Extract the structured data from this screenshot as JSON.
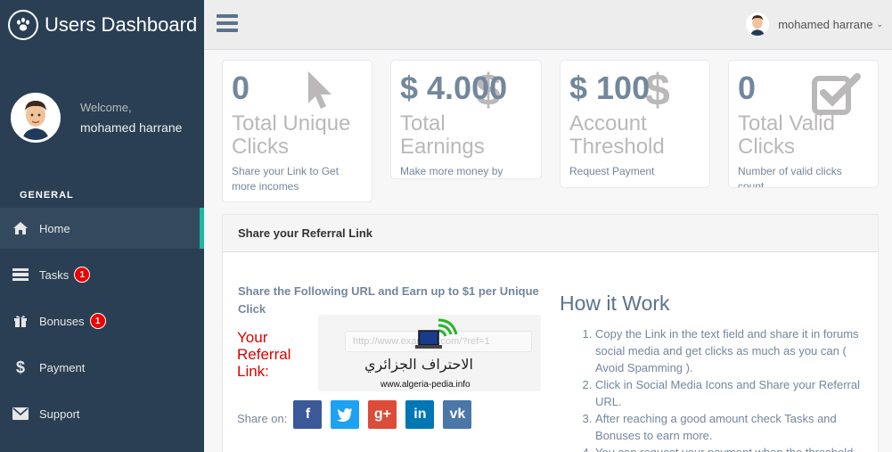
{
  "brand": {
    "title": "Users Dashboard"
  },
  "profile": {
    "welcome": "Welcome,",
    "name": "mohamed harrane"
  },
  "sidebar": {
    "section_label": "GENERAL",
    "items": [
      {
        "label": "Home",
        "icon": "home-icon",
        "badge": ""
      },
      {
        "label": "Tasks",
        "icon": "tasks-icon",
        "badge": "1"
      },
      {
        "label": "Bonuses",
        "icon": "gift-icon",
        "badge": "1"
      },
      {
        "label": "Payment",
        "icon": "dollar-icon",
        "badge": ""
      },
      {
        "label": "Support",
        "icon": "envelope-icon",
        "badge": ""
      }
    ]
  },
  "topbar": {
    "user_name": "mohamed harrane"
  },
  "tiles": [
    {
      "count": "0",
      "title": "Total Unique Clicks",
      "sub": "Share your Link to Get more incomes",
      "icon": "cursor-icon"
    },
    {
      "count": "$ 4.000",
      "title": "Total Earnings",
      "sub": "Make more money by Completing tasks",
      "icon": "dollar-icon"
    },
    {
      "count": "$ 100",
      "title": "Account Threshold",
      "sub": "Request Payment",
      "icon": "dollar-icon"
    },
    {
      "count": "0",
      "title": "Total Valid Clicks",
      "sub": "Number of valid clicks count.",
      "icon": "check-square-icon"
    }
  ],
  "panel": {
    "title": "Share your Referral Link",
    "share_heading": "Share the Following URL and Earn up to $1 per Unique Click",
    "ref_label": "Your Referral Link:",
    "ref_url": "http://www.example.com/?ref=1",
    "watermark_arabic": "الاحتراف الجزائري",
    "watermark_url": "www.algeria-pedia.info",
    "share_label": "Share on:",
    "social": [
      {
        "name": "facebook",
        "glyph": "f",
        "color": "#3b5998"
      },
      {
        "name": "twitter",
        "glyph": "t",
        "color": "#1da1f2"
      },
      {
        "name": "google-plus",
        "glyph": "g+",
        "color": "#dd4b39"
      },
      {
        "name": "linkedin",
        "glyph": "in",
        "color": "#0077b5"
      },
      {
        "name": "vk",
        "glyph": "vk",
        "color": "#4a76a8"
      }
    ],
    "how_title": "How it Work",
    "how_steps": [
      "Copy the Link in the text field and share it in forums social media and get clicks as much as you can ( Avoid Spamming ).",
      "Click in Social Media Icons and Share your Referral URL.",
      "After reaching a good amount check Tasks and Bonuses to earn more.",
      "You can request your payment when the threshold"
    ]
  }
}
